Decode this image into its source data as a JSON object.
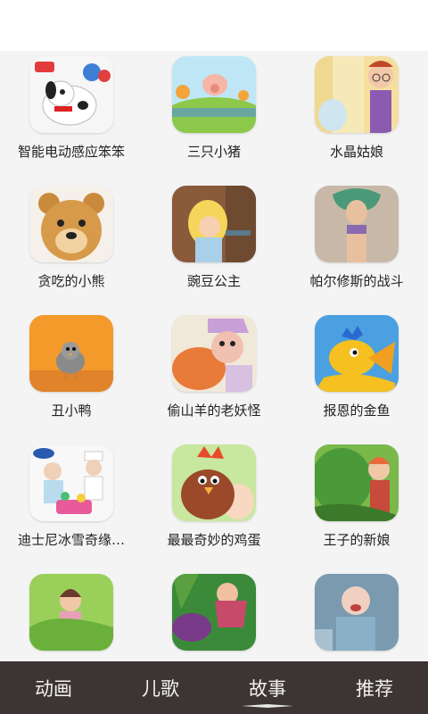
{
  "grid": {
    "items": [
      {
        "label": "智能电动感应笨笨"
      },
      {
        "label": "三只小猪"
      },
      {
        "label": "水晶姑娘"
      },
      {
        "label": "贪吃的小熊"
      },
      {
        "label": "豌豆公主"
      },
      {
        "label": "帕尔修斯的战斗"
      },
      {
        "label": "丑小鸭"
      },
      {
        "label": "偷山羊的老妖怪"
      },
      {
        "label": "报恩的金鱼"
      },
      {
        "label": "迪士尼冰雪奇缘…"
      },
      {
        "label": "最最奇妙的鸡蛋"
      },
      {
        "label": "王子的新娘"
      },
      {
        "label": ""
      },
      {
        "label": ""
      },
      {
        "label": ""
      }
    ]
  },
  "navbar": {
    "tabs": [
      {
        "label": "动画"
      },
      {
        "label": "儿歌"
      },
      {
        "label": "故事"
      },
      {
        "label": "推荐"
      }
    ],
    "active_index": 2
  },
  "colors": {
    "navbar_bg": "#3d3533",
    "grid_bg": "#f4f4f4"
  }
}
